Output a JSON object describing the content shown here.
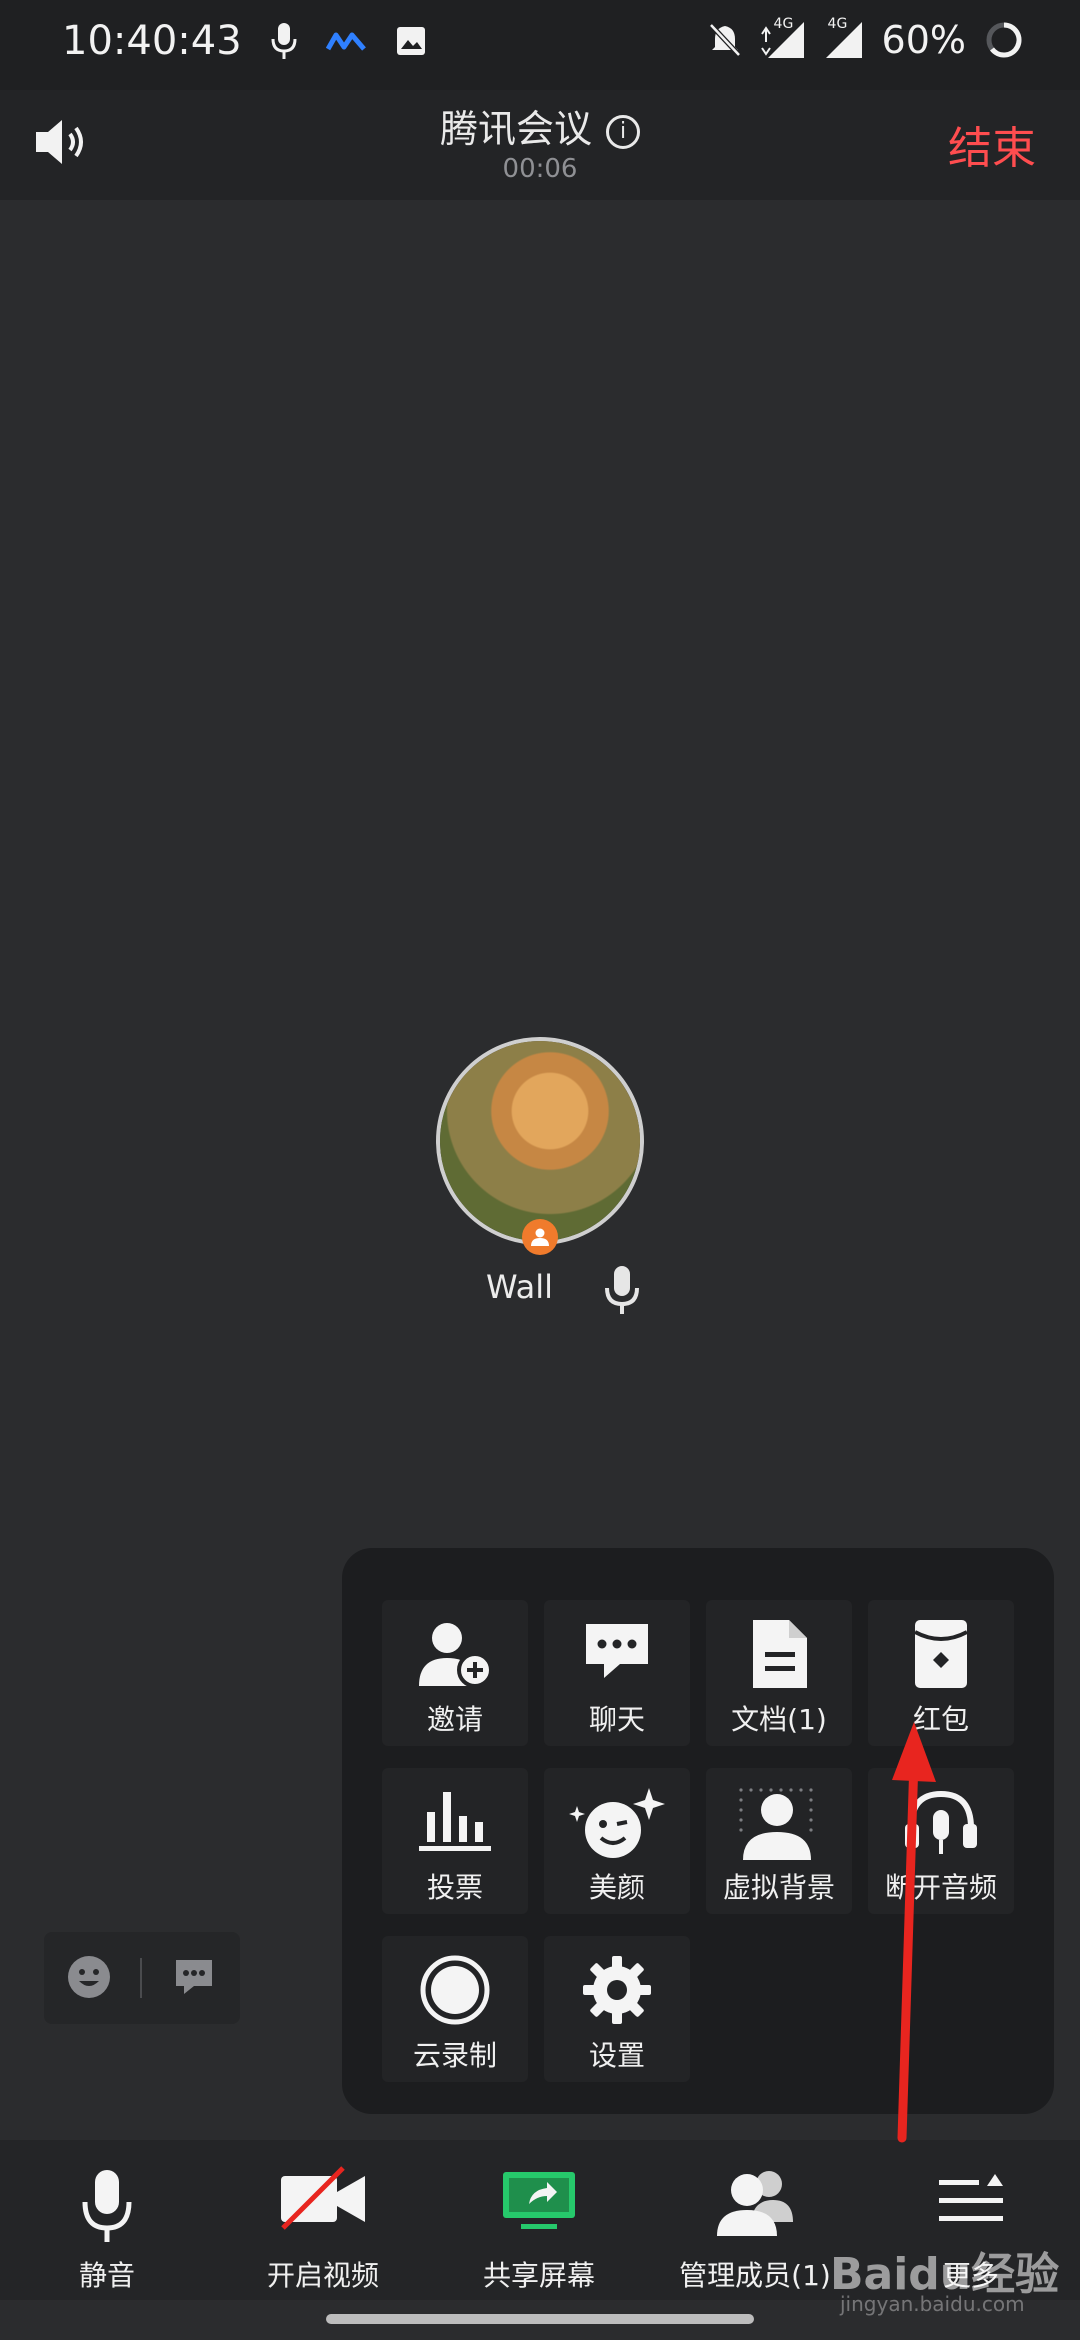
{
  "status_bar": {
    "time": "10:40:43",
    "network_label": "4G",
    "network_label_2": "4G",
    "battery": "60%"
  },
  "header": {
    "title": "腾讯会议",
    "timer": "00:06",
    "end_label": "结束"
  },
  "participant": {
    "name": "Wall"
  },
  "more_menu": {
    "items": [
      {
        "label": "邀请",
        "icon": "invite-icon"
      },
      {
        "label": "聊天",
        "icon": "chat-icon"
      },
      {
        "label": "文档(1)",
        "icon": "document-icon"
      },
      {
        "label": "红包",
        "icon": "red-packet-icon"
      },
      {
        "label": "投票",
        "icon": "vote-icon"
      },
      {
        "label": "美颜",
        "icon": "beauty-icon"
      },
      {
        "label": "虚拟背景",
        "icon": "virtual-background-icon"
      },
      {
        "label": "断开音频",
        "icon": "disconnect-audio-icon"
      },
      {
        "label": "云录制",
        "icon": "cloud-record-icon"
      },
      {
        "label": "设置",
        "icon": "settings-icon"
      }
    ]
  },
  "toolbar": {
    "mute": "静音",
    "video": "开启视频",
    "share": "共享屏幕",
    "members": "管理成员(1)",
    "more": "更多"
  },
  "watermark": {
    "brand": "Baidu经验",
    "url": "jingyan.baidu.com"
  },
  "colors": {
    "end_red": "#ff4d4f",
    "share_green": "#26c96b",
    "badge_orange": "#f07b2c",
    "annotation_red": "#e8251f"
  }
}
